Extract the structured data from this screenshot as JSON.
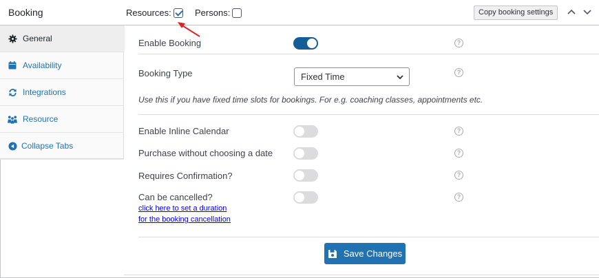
{
  "header": {
    "title": "Booking",
    "resources_label": "Resources:",
    "resources_checked": true,
    "persons_label": "Persons:",
    "persons_checked": false,
    "copy_button": "Copy booking settings",
    "collapse_up_icon": "chevron-up-icon",
    "collapse_down_icon": "chevron-down-icon"
  },
  "sidebar": {
    "items": [
      {
        "label": "General",
        "icon": "gear-icon",
        "active": true
      },
      {
        "label": "Availability",
        "icon": "calendar-icon",
        "active": false
      },
      {
        "label": "Integrations",
        "icon": "sync-icon",
        "active": false
      },
      {
        "label": "Resource",
        "icon": "people-icon",
        "active": false
      },
      {
        "label": "Collapse Tabs",
        "icon": "collapse-left-icon",
        "active": false
      }
    ]
  },
  "general": {
    "enable_booking": {
      "label": "Enable Booking",
      "on": true
    },
    "booking_type": {
      "label": "Booking Type",
      "value": "Fixed Time"
    },
    "hint": "Use this if you have fixed time slots for bookings. For e.g. coaching classes, appointments etc.",
    "inline_calendar": {
      "label": "Enable Inline Calendar",
      "on": false
    },
    "purchase_without_date": {
      "label": "Purchase without choosing a date",
      "on": false
    },
    "requires_confirmation": {
      "label": "Requires Confirmation?",
      "on": false
    },
    "can_be_cancelled": {
      "label": "Can be cancelled?",
      "on": false,
      "link_line1": "click here to set a duration",
      "link_line2": "for the booking cancellation"
    },
    "help_icon": "help-icon",
    "help_glyph": "?"
  },
  "footer": {
    "save_label": "Save Changes",
    "save_icon": "save-disk-icon"
  },
  "colors": {
    "accent": "#2271b1",
    "toggle_on": "#135e96",
    "toggle_off": "#dcdcde",
    "annotation_arrow": "#e02424"
  }
}
